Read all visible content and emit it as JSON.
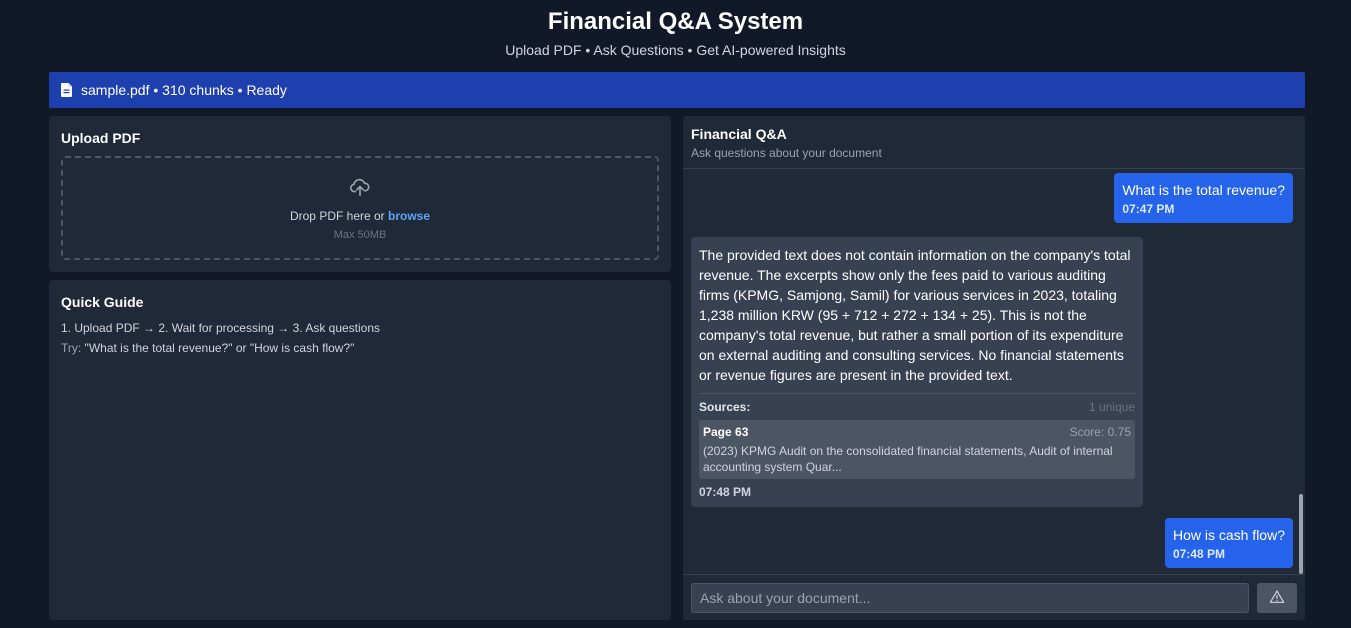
{
  "header": {
    "title": "Financial Q&A System",
    "subtitle": "Upload PDF • Ask Questions • Get AI-powered Insights"
  },
  "status": {
    "text": "sample.pdf • 310 chunks • Ready",
    "icon": "file-icon"
  },
  "upload": {
    "title": "Upload PDF",
    "drop_text": "Drop PDF here or ",
    "browse_label": "browse",
    "hint": "Max 50MB",
    "icon": "upload-cloud-icon"
  },
  "guide": {
    "title": "Quick Guide",
    "steps": "1. Upload PDF → 2. Wait for processing → 3. Ask questions",
    "try_label": "Try:",
    "try_text": " \"What is the total revenue?\" or \"How is cash flow?\""
  },
  "chat": {
    "title": "Financial Q&A",
    "subtitle": "Ask questions about your document",
    "messages": [
      {
        "role": "user",
        "text": "What is the total revenue?",
        "time": "07:47 PM"
      },
      {
        "role": "assistant",
        "text": "The provided text does not contain information on the company's total revenue.  The excerpts show only the fees paid to various auditing firms (KPMG, Samjong, Samil) for various services in 2023, totaling 1,238 million KRW (95 + 712 + 272 + 134 + 25).  This is not the company's total revenue, but rather a small portion of its expenditure on external auditing and consulting services.  No financial statements or revenue figures are present in the provided text.",
        "sources_label": "Sources:",
        "sources_count": "1 unique",
        "sources": [
          {
            "page": "Page 63",
            "score": "Score: 0.75",
            "excerpt": "(2023) KPMG Audit on the consolidated financial statements, Audit of internal accounting system Quar..."
          }
        ],
        "time": "07:48 PM"
      },
      {
        "role": "user",
        "text": "How is cash flow?",
        "time": "07:48 PM"
      }
    ],
    "input_placeholder": "Ask about your document...",
    "send_icon": "warning-triangle-icon"
  },
  "colors": {
    "background": "#111827",
    "panel": "#1f2937",
    "status_bar": "#1e40af",
    "user_bubble": "#2563eb",
    "bot_bubble": "#374151",
    "link": "#60a5fa"
  }
}
